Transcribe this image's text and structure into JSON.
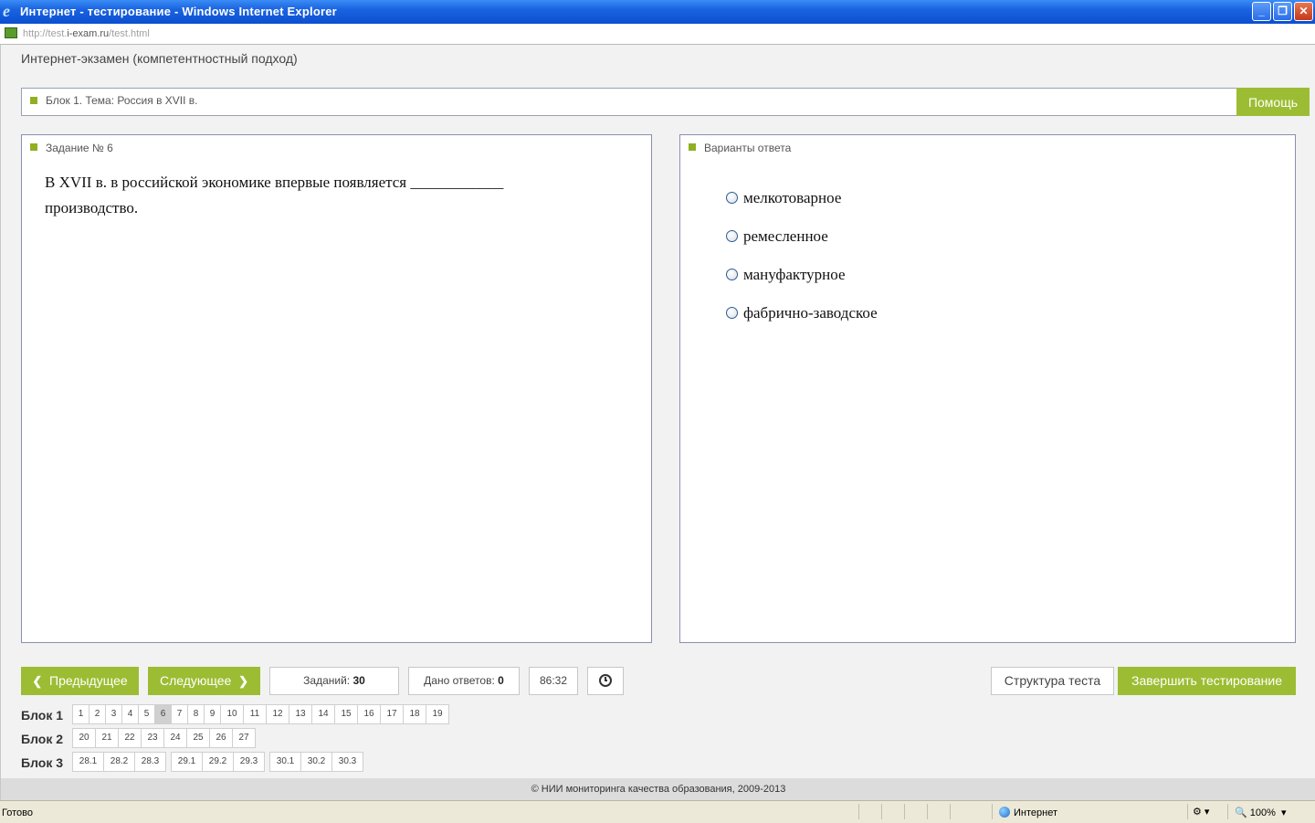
{
  "window": {
    "title": "Интернет - тестирование - Windows Internet Explorer",
    "minimize": "_",
    "restore": "❐",
    "close": "✕"
  },
  "address": {
    "prefix": "http://test.",
    "domain": "i-exam.ru",
    "path": "/test.html"
  },
  "app": {
    "title": "Интернет-экзамен (компетентностный подход)"
  },
  "block_bar": {
    "label": "Блок 1. Тема: Россия в XVII в.",
    "help": "Помощь"
  },
  "task": {
    "title": "Задание № 6",
    "text": "В XVII в. в российской экономике впервые появляется ____________ производство."
  },
  "answers": {
    "title": "Варианты ответа",
    "options": [
      "мелкотоварное",
      "ремесленное",
      "мануфактурное",
      "фабрично-заводское"
    ]
  },
  "controls": {
    "prev": "Предыдущее",
    "next": "Следующее",
    "tasks_label": "Заданий:",
    "tasks_count": "30",
    "answered_label": "Дано ответов:",
    "answered_count": "0",
    "timer": "86:32",
    "structure": "Структура теста",
    "finish": "Завершить тестирование"
  },
  "nav": {
    "block1": {
      "label": "Блок 1",
      "items": [
        "1",
        "2",
        "3",
        "4",
        "5",
        "6",
        "7",
        "8",
        "9",
        "10",
        "11",
        "12",
        "13",
        "14",
        "15",
        "16",
        "17",
        "18",
        "19"
      ],
      "active": "6"
    },
    "block2": {
      "label": "Блок 2",
      "items": [
        "20",
        "21",
        "22",
        "23",
        "24",
        "25",
        "26",
        "27"
      ]
    },
    "block3": {
      "label": "Блок 3",
      "groups": [
        [
          "28.1",
          "28.2",
          "28.3"
        ],
        [
          "29.1",
          "29.2",
          "29.3"
        ],
        [
          "30.1",
          "30.2",
          "30.3"
        ]
      ]
    }
  },
  "footer": {
    "text": "© НИИ мониторинга качества образования, 2009-2013"
  },
  "status": {
    "ready": "Готово",
    "zone": "Интернет",
    "zoom": "100%"
  },
  "colors": {
    "accent": "#9cbd33",
    "titlebar": "#1a63e0"
  }
}
